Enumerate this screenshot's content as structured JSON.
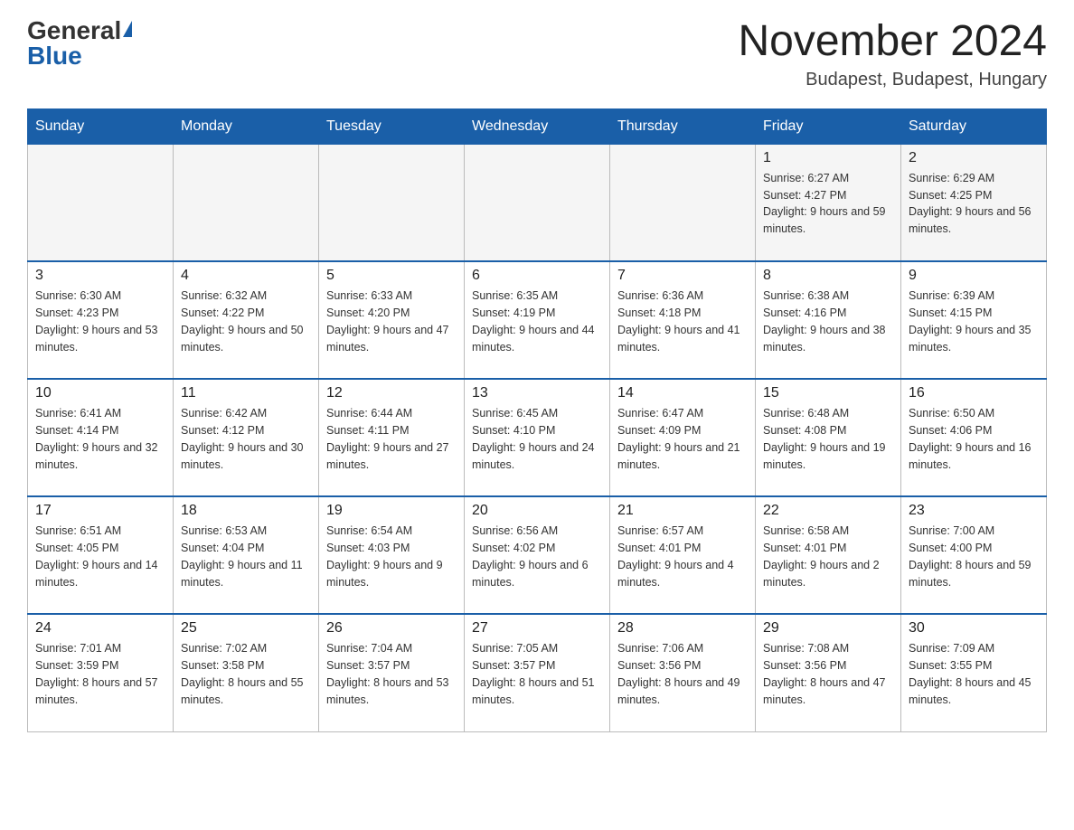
{
  "header": {
    "logo_general": "General",
    "logo_blue": "Blue",
    "title": "November 2024",
    "location": "Budapest, Budapest, Hungary"
  },
  "days_of_week": [
    "Sunday",
    "Monday",
    "Tuesday",
    "Wednesday",
    "Thursday",
    "Friday",
    "Saturday"
  ],
  "weeks": [
    [
      {
        "day": "",
        "info": ""
      },
      {
        "day": "",
        "info": ""
      },
      {
        "day": "",
        "info": ""
      },
      {
        "day": "",
        "info": ""
      },
      {
        "day": "",
        "info": ""
      },
      {
        "day": "1",
        "info": "Sunrise: 6:27 AM\nSunset: 4:27 PM\nDaylight: 9 hours and 59 minutes."
      },
      {
        "day": "2",
        "info": "Sunrise: 6:29 AM\nSunset: 4:25 PM\nDaylight: 9 hours and 56 minutes."
      }
    ],
    [
      {
        "day": "3",
        "info": "Sunrise: 6:30 AM\nSunset: 4:23 PM\nDaylight: 9 hours and 53 minutes."
      },
      {
        "day": "4",
        "info": "Sunrise: 6:32 AM\nSunset: 4:22 PM\nDaylight: 9 hours and 50 minutes."
      },
      {
        "day": "5",
        "info": "Sunrise: 6:33 AM\nSunset: 4:20 PM\nDaylight: 9 hours and 47 minutes."
      },
      {
        "day": "6",
        "info": "Sunrise: 6:35 AM\nSunset: 4:19 PM\nDaylight: 9 hours and 44 minutes."
      },
      {
        "day": "7",
        "info": "Sunrise: 6:36 AM\nSunset: 4:18 PM\nDaylight: 9 hours and 41 minutes."
      },
      {
        "day": "8",
        "info": "Sunrise: 6:38 AM\nSunset: 4:16 PM\nDaylight: 9 hours and 38 minutes."
      },
      {
        "day": "9",
        "info": "Sunrise: 6:39 AM\nSunset: 4:15 PM\nDaylight: 9 hours and 35 minutes."
      }
    ],
    [
      {
        "day": "10",
        "info": "Sunrise: 6:41 AM\nSunset: 4:14 PM\nDaylight: 9 hours and 32 minutes."
      },
      {
        "day": "11",
        "info": "Sunrise: 6:42 AM\nSunset: 4:12 PM\nDaylight: 9 hours and 30 minutes."
      },
      {
        "day": "12",
        "info": "Sunrise: 6:44 AM\nSunset: 4:11 PM\nDaylight: 9 hours and 27 minutes."
      },
      {
        "day": "13",
        "info": "Sunrise: 6:45 AM\nSunset: 4:10 PM\nDaylight: 9 hours and 24 minutes."
      },
      {
        "day": "14",
        "info": "Sunrise: 6:47 AM\nSunset: 4:09 PM\nDaylight: 9 hours and 21 minutes."
      },
      {
        "day": "15",
        "info": "Sunrise: 6:48 AM\nSunset: 4:08 PM\nDaylight: 9 hours and 19 minutes."
      },
      {
        "day": "16",
        "info": "Sunrise: 6:50 AM\nSunset: 4:06 PM\nDaylight: 9 hours and 16 minutes."
      }
    ],
    [
      {
        "day": "17",
        "info": "Sunrise: 6:51 AM\nSunset: 4:05 PM\nDaylight: 9 hours and 14 minutes."
      },
      {
        "day": "18",
        "info": "Sunrise: 6:53 AM\nSunset: 4:04 PM\nDaylight: 9 hours and 11 minutes."
      },
      {
        "day": "19",
        "info": "Sunrise: 6:54 AM\nSunset: 4:03 PM\nDaylight: 9 hours and 9 minutes."
      },
      {
        "day": "20",
        "info": "Sunrise: 6:56 AM\nSunset: 4:02 PM\nDaylight: 9 hours and 6 minutes."
      },
      {
        "day": "21",
        "info": "Sunrise: 6:57 AM\nSunset: 4:01 PM\nDaylight: 9 hours and 4 minutes."
      },
      {
        "day": "22",
        "info": "Sunrise: 6:58 AM\nSunset: 4:01 PM\nDaylight: 9 hours and 2 minutes."
      },
      {
        "day": "23",
        "info": "Sunrise: 7:00 AM\nSunset: 4:00 PM\nDaylight: 8 hours and 59 minutes."
      }
    ],
    [
      {
        "day": "24",
        "info": "Sunrise: 7:01 AM\nSunset: 3:59 PM\nDaylight: 8 hours and 57 minutes."
      },
      {
        "day": "25",
        "info": "Sunrise: 7:02 AM\nSunset: 3:58 PM\nDaylight: 8 hours and 55 minutes."
      },
      {
        "day": "26",
        "info": "Sunrise: 7:04 AM\nSunset: 3:57 PM\nDaylight: 8 hours and 53 minutes."
      },
      {
        "day": "27",
        "info": "Sunrise: 7:05 AM\nSunset: 3:57 PM\nDaylight: 8 hours and 51 minutes."
      },
      {
        "day": "28",
        "info": "Sunrise: 7:06 AM\nSunset: 3:56 PM\nDaylight: 8 hours and 49 minutes."
      },
      {
        "day": "29",
        "info": "Sunrise: 7:08 AM\nSunset: 3:56 PM\nDaylight: 8 hours and 47 minutes."
      },
      {
        "day": "30",
        "info": "Sunrise: 7:09 AM\nSunset: 3:55 PM\nDaylight: 8 hours and 45 minutes."
      }
    ]
  ]
}
